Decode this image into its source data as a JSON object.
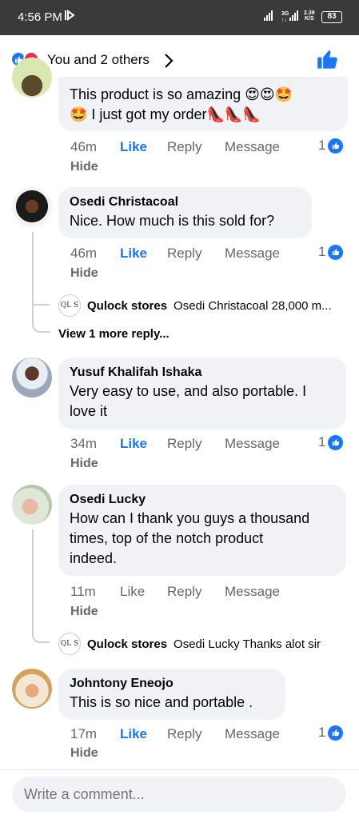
{
  "status_bar": {
    "time": "4:56 PM",
    "network_top": "3G",
    "network_bottom": "↑↓",
    "speed_value": "2.39",
    "speed_unit": "K/S",
    "battery": "83"
  },
  "header": {
    "reactions_text": "You and 2 others",
    "reaction_icons": [
      "like-icon",
      "love-icon"
    ]
  },
  "colors": {
    "accent": "#1877f2",
    "bubble": "#f0f2f5",
    "muted": "#65676b",
    "love": "#f02849"
  },
  "comments": [
    {
      "name": "",
      "text_line1": "This product is so amazing 😍😍🤩",
      "text_line2": "🤩 I just got my order👠👠👠",
      "time": "46m",
      "like": "Like",
      "reply": "Reply",
      "message": "Message",
      "likes": "1",
      "hide": "Hide"
    },
    {
      "name": "Osedi Christacoal",
      "text": "Nice. How much is this sold for?",
      "time": "46m",
      "like": "Like",
      "reply": "Reply",
      "message": "Message",
      "likes": "1",
      "hide": "Hide",
      "reply_preview": {
        "logo": "QL S",
        "name": "Qulock stores",
        "text": "Osedi Christacoal 28,000 m..."
      },
      "more_replies": "View 1 more reply..."
    },
    {
      "name": "Yusuf Khalifah Ishaka",
      "text_line1": "Very easy to use, and also portable. I",
      "text_line2": "love it",
      "time": "34m",
      "like": "Like",
      "reply": "Reply",
      "message": "Message",
      "likes": "1",
      "hide": "Hide"
    },
    {
      "name": "Osedi Lucky",
      "text_line1": "How can I thank you guys a thousand",
      "text_line2": "times, top of the notch product",
      "text_line3": "indeed.",
      "time": "11m",
      "like": "Like",
      "reply": "Reply",
      "message": "Message",
      "hide": "Hide",
      "reply_preview": {
        "logo": "QL S",
        "name": "Qulock stores",
        "text": "Osedi Lucky Thanks alot sir"
      }
    },
    {
      "name": "Johntony Eneojo",
      "text": "This is so nice and portable .",
      "time": "17m",
      "like": "Like",
      "reply": "Reply",
      "message": "Message",
      "likes": "1",
      "hide": "Hide"
    }
  ],
  "composer": {
    "placeholder": "Write a comment..."
  }
}
